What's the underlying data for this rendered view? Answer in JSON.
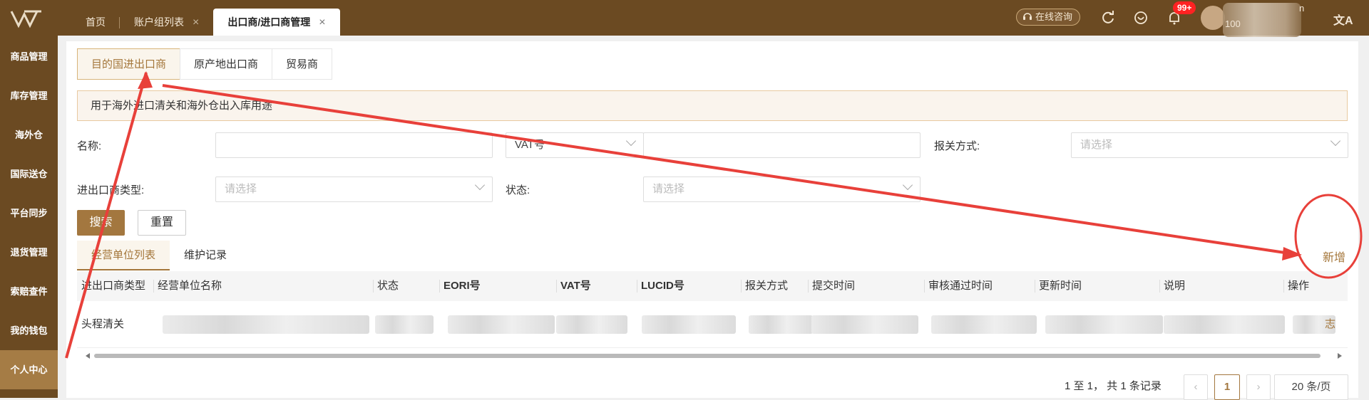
{
  "topbar": {
    "tabs": [
      {
        "label": "首页",
        "closable": false
      },
      {
        "label": "账户组列表",
        "closable": true
      },
      {
        "label": "出口商/进口商管理",
        "closable": true,
        "active": true
      }
    ],
    "close_glyph": "×",
    "consult_label": "在线咨询",
    "notification_badge": "99+",
    "user_line1": "n",
    "user_line2": "100",
    "language_glyph": "文A",
    "icons": [
      "headset-icon",
      "refresh-icon",
      "heart-icon",
      "bell-icon",
      "translate-icon"
    ]
  },
  "sidebar": {
    "items": [
      "商品管理",
      "库存管理",
      "海外仓",
      "国际送仓",
      "平台同步",
      "退货管理",
      "索赔查件",
      "我的钱包",
      "个人中心"
    ],
    "active_index": 8
  },
  "sub_tabs": [
    "目的国进出口商",
    "原产地出口商",
    "贸易商"
  ],
  "notice": "用于海外进口清关和海外仓出入库用途",
  "form": {
    "name_label": "名称:",
    "vat_select_value": "VAT号",
    "customs_label": "报关方式:",
    "customs_placeholder": "请选择",
    "type_label": "进出口商类型:",
    "type_placeholder": "请选择",
    "status_label": "状态:",
    "status_placeholder": "请选择",
    "search_button": "搜索",
    "reset_button": "重置"
  },
  "list_tabs": [
    "经营单位列表",
    "维护记录"
  ],
  "add_link": "新增",
  "table": {
    "headers": [
      "进出口商类型",
      "经营单位名称",
      "状态",
      "EORI号",
      "VAT号",
      "LUCID号",
      "报关方式",
      "提交时间",
      "审核通过时间",
      "更新时间",
      "说明",
      "操作"
    ],
    "rows": [
      {
        "type": "头程清关",
        "action_fragment": "志"
      }
    ]
  },
  "pagination": {
    "summary": "1 至 1， 共 1 条记录",
    "prev": "‹",
    "current": "1",
    "next": "›",
    "page_size": "20 条/页"
  },
  "colors": {
    "brand_dark": "#6b4a22",
    "brand_accent": "#a3773f",
    "annotation_red": "#e8403a"
  }
}
